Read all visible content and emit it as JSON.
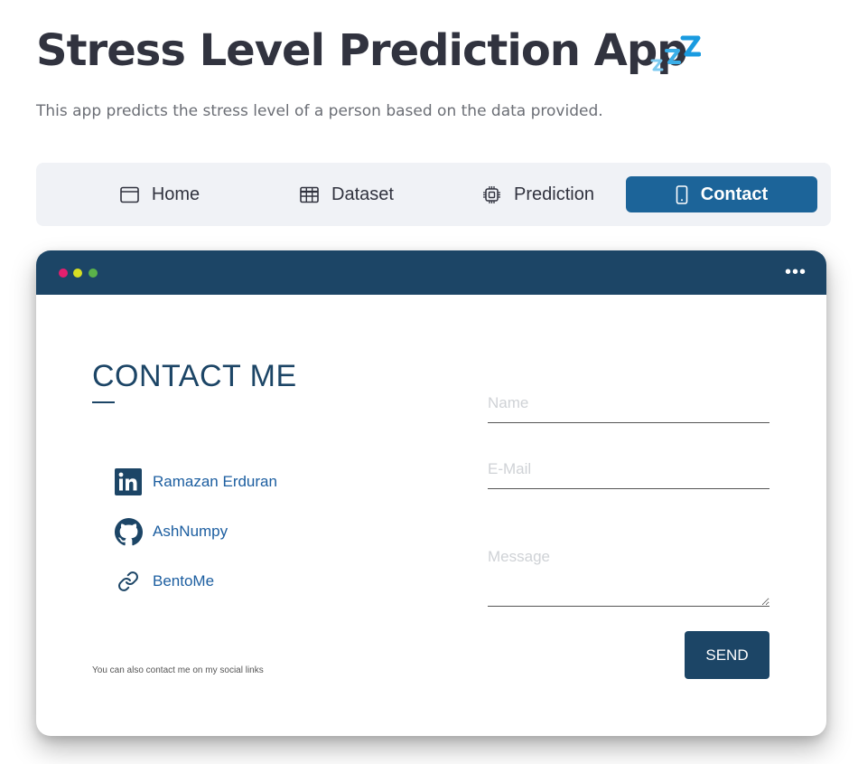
{
  "header": {
    "title": "Stress Level Prediction App",
    "title_icon": "zzz-sleep-icon",
    "subtitle": "This app predicts the stress level of a person based on the data provided."
  },
  "nav": {
    "items": [
      {
        "label": "Home",
        "icon": "window-icon",
        "active": false
      },
      {
        "label": "Dataset",
        "icon": "table-icon",
        "active": false
      },
      {
        "label": "Prediction",
        "icon": "cpu-icon",
        "active": false
      },
      {
        "label": "Contact",
        "icon": "phone-icon",
        "active": true
      }
    ],
    "active_color": "#1c6499",
    "background_color": "#f0f2f6"
  },
  "contact_card": {
    "window_dots": [
      "#e31f6e",
      "#d7df23",
      "#5ab24a"
    ],
    "bar_color": "#1c4566",
    "menu_icon": "more-horizontal-icon",
    "heading": "CONTACT ME",
    "social_links": [
      {
        "label": "Ramazan Erduran",
        "icon": "linkedin-icon"
      },
      {
        "label": "AshNumpy",
        "icon": "github-icon"
      },
      {
        "label": "BentoMe",
        "icon": "link-icon"
      }
    ],
    "footer_note": "You can also contact me on my social links",
    "form": {
      "name_placeholder": "Name",
      "email_placeholder": "E-Mail",
      "message_placeholder": "Message",
      "send_label": "SEND"
    }
  }
}
